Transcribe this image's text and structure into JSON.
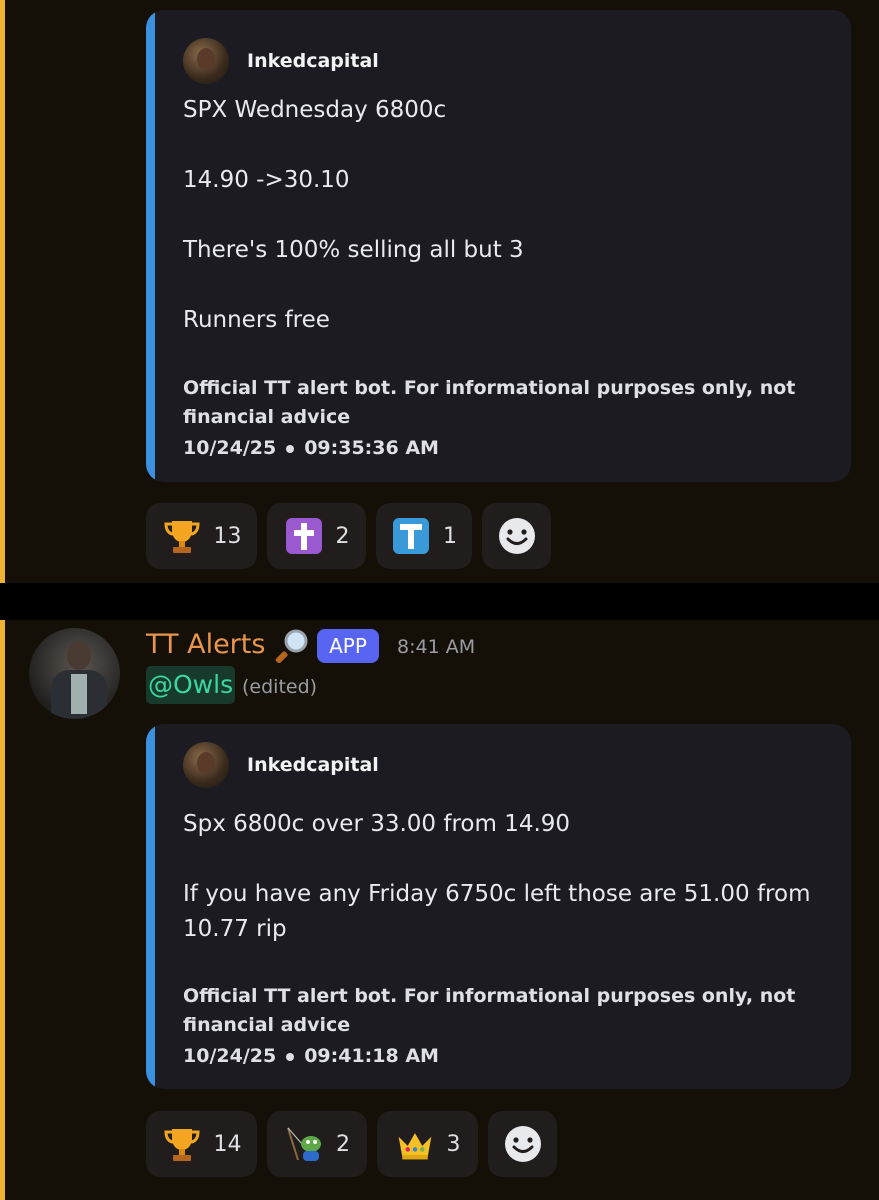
{
  "message1": {
    "embed": {
      "author": "Inkedcapital",
      "lines": [
        "SPX Wednesday 6800c",
        "14.90 ->30.10",
        "There's 100% selling all but 3",
        "Runners free"
      ],
      "footer_line1": "Official TT alert bot. For informational purposes only, not",
      "footer_line2": "financial advice",
      "date": "10/24/25",
      "time": "09:35:36 AM"
    },
    "reactions": [
      {
        "icon": "trophy",
        "emoji": "🏆",
        "count": "13"
      },
      {
        "icon": "latin-cross",
        "emoji": "✝",
        "count": "2"
      },
      {
        "icon": "letter-t",
        "emoji": "T",
        "count": "1"
      },
      {
        "icon": "add-reaction",
        "emoji": "☻",
        "count": ""
      }
    ]
  },
  "message2": {
    "username": "TT Alerts",
    "username_icon": "magnifying-glass",
    "badge": "APP",
    "time": "8:41 AM",
    "mention": "@Owls",
    "edited": "(edited)",
    "embed": {
      "author": "Inkedcapital",
      "lines": [
        "Spx 6800c over 33.00 from 14.90",
        "If you have any Friday 6750c left those are 51.00 from",
        "10.77 rip"
      ],
      "footer_line1": "Official TT alert bot. For informational purposes only, not",
      "footer_line2": "financial advice",
      "date": "10/24/25",
      "time": "09:41:18 AM"
    },
    "reactions": [
      {
        "icon": "trophy",
        "emoji": "🏆",
        "count": "14"
      },
      {
        "icon": "pepe-fishing",
        "emoji": "🎣",
        "count": "2"
      },
      {
        "icon": "crown",
        "emoji": "👑",
        "count": "3"
      },
      {
        "icon": "add-reaction",
        "emoji": "☻",
        "count": ""
      }
    ]
  },
  "colors": {
    "background": "#140f07",
    "highlight": "#f0b232",
    "embed_accent": "#3b91e0",
    "username": "#e9964d",
    "badge": "#5865f2",
    "mention": "#3ad8a0"
  }
}
